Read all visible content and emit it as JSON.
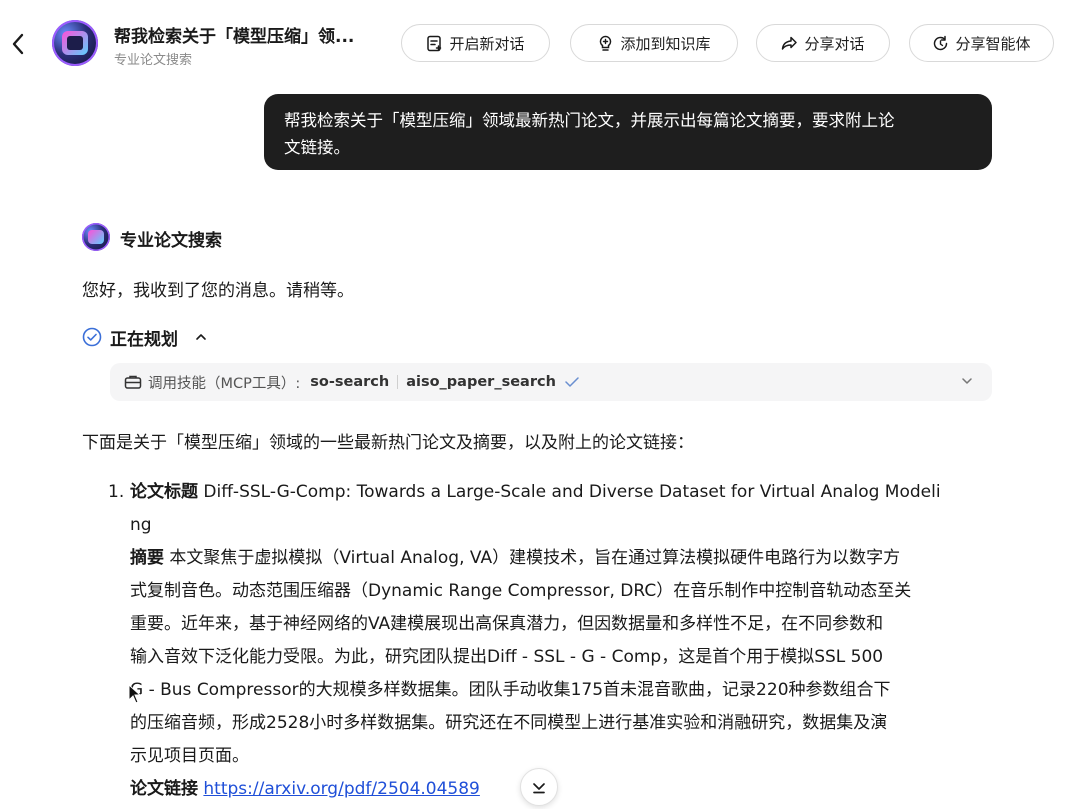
{
  "header": {
    "title": "帮我检索关于「模型压缩」领...",
    "subtitle": "专业论文搜索",
    "buttons": {
      "new_chat": "开启新对话",
      "add_kb": "添加到知识库",
      "share_chat": "分享对话",
      "share_agent": "分享智能体"
    }
  },
  "user_message": {
    "line1": "帮我检索关于「模型压缩」领域最新热门论文，并展示出每篇论文摘要，要求附上论",
    "line2": "文链接。"
  },
  "bot": {
    "name": "专业论文搜索",
    "greeting": "您好，我收到了您的消息。请稍等。",
    "plan_label": "正在规划",
    "tool": {
      "prefix": "调用技能（MCP工具）:",
      "server": "so-search",
      "name": "aiso_paper_search"
    },
    "intro": "下面是关于「模型压缩」领域的一些最新热门论文及摘要，以及附上的论文链接："
  },
  "papers": [
    {
      "index": "1.",
      "title_label": "论文标题",
      "title_line1": " Diff-SSL-G-Comp: Towards a Large-Scale and Diverse Dataset for Virtual Analog Modeli",
      "title_line2": "ng",
      "abstract_label": "摘要",
      "abstract_lines": [
        " 本文聚焦于虚拟模拟（Virtual Analog, VA）建模技术，旨在通过算法模拟硬件电路行为以数字方",
        "式复制音色。动态范围压缩器（Dynamic Range Compressor, DRC）在音乐制作中控制音轨动态至关",
        "重要。近年来，基于神经网络的VA建模展现出高保真潜力，但因数据量和多样性不足，在不同参数和",
        "输入音效下泛化能力受限。为此，研究团队提出Diff - SSL - G - Comp，这是首个用于模拟SSL 500",
        "G - Bus Compressor的大规模多样数据集。团队手动收集175首未混音歌曲，记录220种参数组合下",
        "的压缩音频，形成2528小时多样数据集。研究还在不同模型上进行基准实验和消融研究，数据集及演",
        "示见项目页面。"
      ],
      "link_label": "论文链接",
      "link": "https://arxiv.org/pdf/2504.04589"
    }
  ],
  "colors": {
    "bubble_bg": "#1e1e1e",
    "link": "#1f4fd8",
    "tool_bg": "#f5f5f6"
  }
}
